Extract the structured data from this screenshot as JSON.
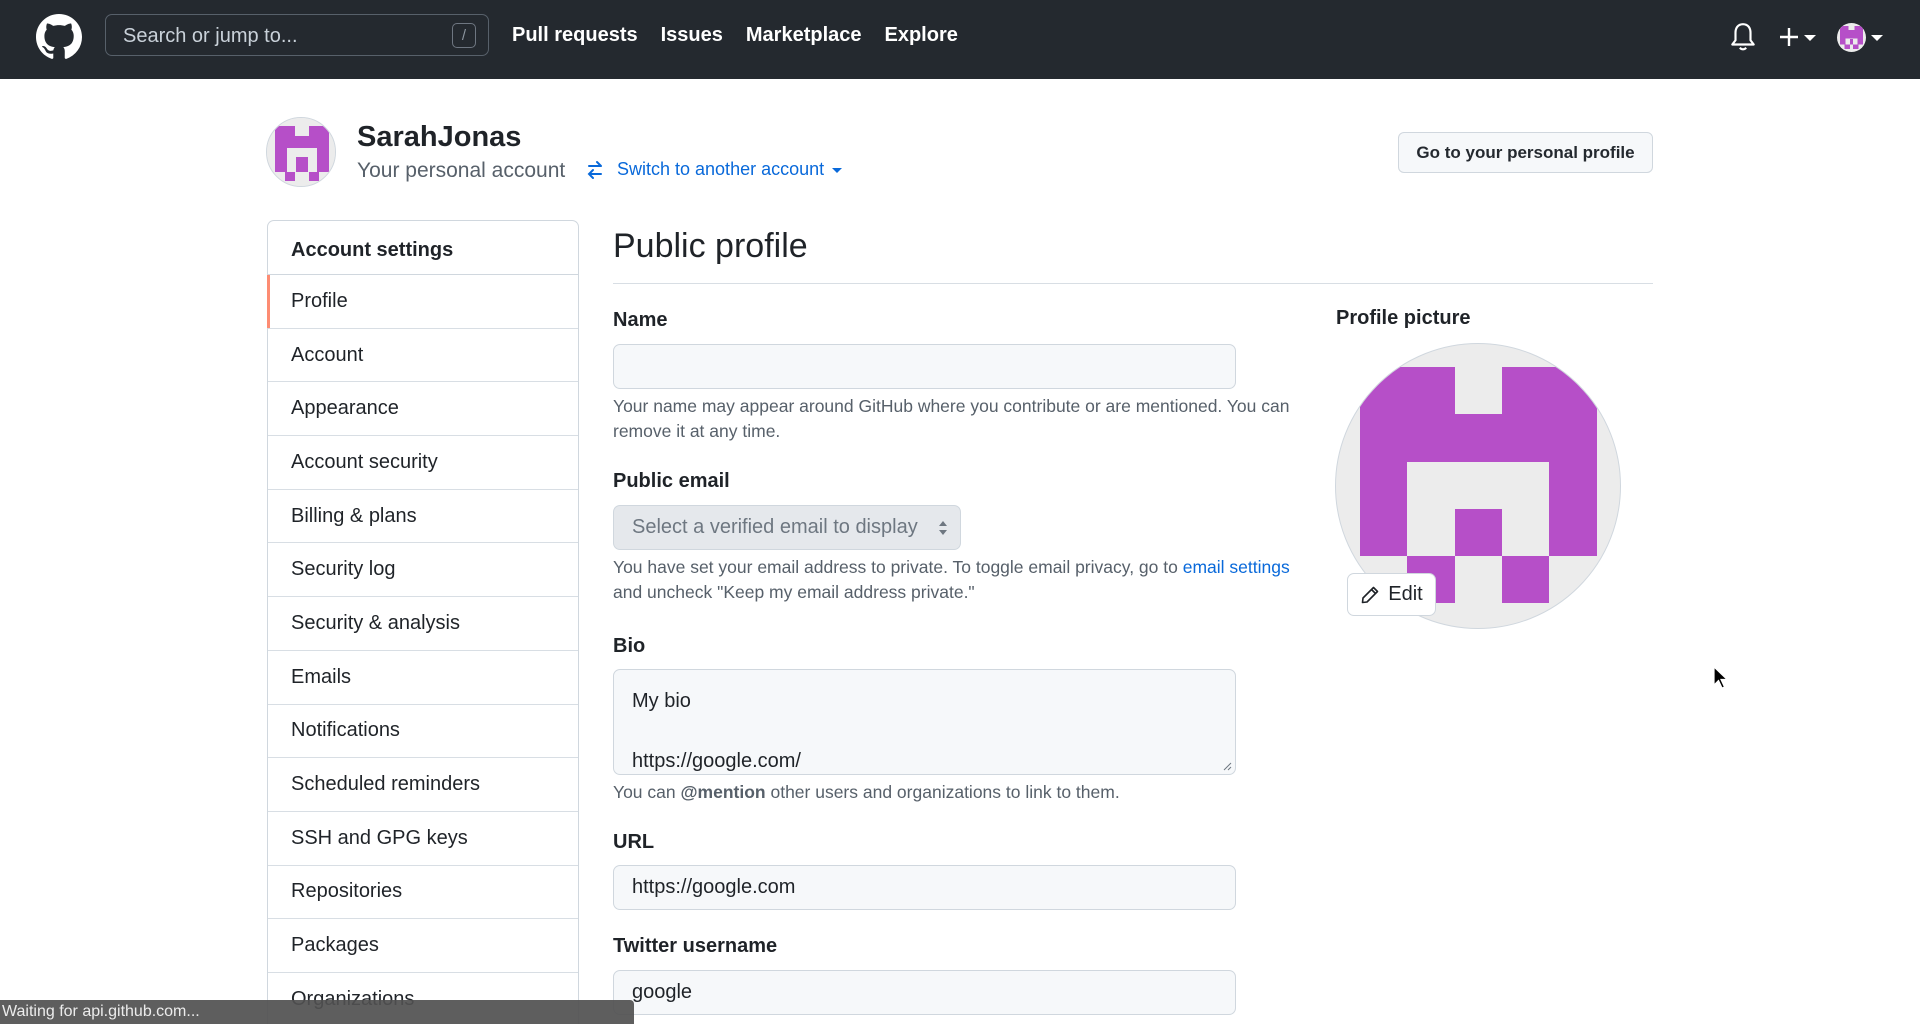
{
  "header": {
    "logo": "github-mark-icon",
    "search_placeholder": "Search or jump to...",
    "search_shortcut": "/",
    "nav": [
      "Pull requests",
      "Issues",
      "Marketplace",
      "Explore"
    ],
    "icons": [
      "bell-icon",
      "plus-icon",
      "avatar"
    ]
  },
  "account": {
    "username": "SarahJonas",
    "subtitle": "Your personal account",
    "switch_label": "Switch to another account",
    "goto_profile_label": "Go to your personal profile",
    "avatar_color": "#b64fc8"
  },
  "sidebar": {
    "heading": "Account settings",
    "active": "Profile",
    "items": [
      {
        "label": "Profile"
      },
      {
        "label": "Account"
      },
      {
        "label": "Appearance"
      },
      {
        "label": "Account security"
      },
      {
        "label": "Billing & plans"
      },
      {
        "label": "Security log"
      },
      {
        "label": "Security & analysis"
      },
      {
        "label": "Emails"
      },
      {
        "label": "Notifications"
      },
      {
        "label": "Scheduled reminders"
      },
      {
        "label": "SSH and GPG keys"
      },
      {
        "label": "Repositories"
      },
      {
        "label": "Packages"
      },
      {
        "label": "Organizations"
      }
    ]
  },
  "main": {
    "title": "Public profile",
    "name": {
      "label": "Name",
      "value": "",
      "note": "Your name may appear around GitHub where you contribute or are mentioned. You can remove it at any time."
    },
    "public_email": {
      "label": "Public email",
      "selected": "Select a verified email to display",
      "note_before": "You have set your email address to private. To toggle email privacy, go to ",
      "note_link": "email settings",
      "note_after": " and uncheck \"Keep my email address private.\""
    },
    "bio": {
      "label": "Bio",
      "value": "My bio\n\nhttps://google.com/",
      "note_before": "You can ",
      "note_bold": "@mention",
      "note_after": " other users and organizations to link to them."
    },
    "url": {
      "label": "URL",
      "value": "https://google.com"
    },
    "twitter": {
      "label": "Twitter username",
      "value": "google"
    },
    "profile_picture": {
      "label": "Profile picture",
      "edit_label": "Edit"
    }
  },
  "status_bar": {
    "text": "Waiting for api.github.com..."
  },
  "colors": {
    "header_bg": "#24292f",
    "link": "#0969da",
    "active_indicator": "#fd8c73",
    "identicon": "#b64fc8"
  }
}
